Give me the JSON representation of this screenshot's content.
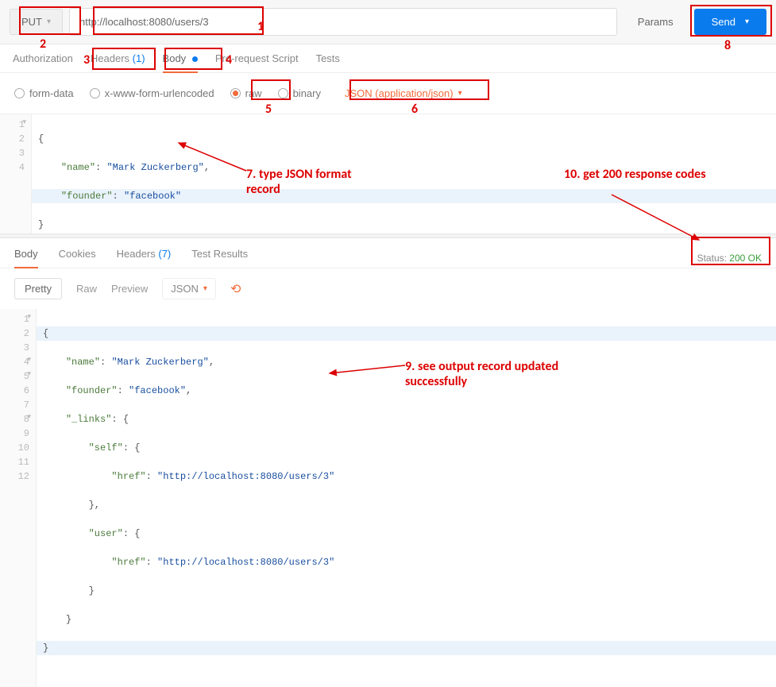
{
  "request": {
    "method": "PUT",
    "url": "http://localhost:8080/users/3",
    "params_btn": "Params",
    "send_btn": "Send"
  },
  "reqTabs": {
    "authorization": "Authorization",
    "headers": "Headers",
    "headers_count": "(1)",
    "body": "Body",
    "prerequest": "Pre-request Script",
    "tests": "Tests"
  },
  "bodyOpts": {
    "formdata": "form-data",
    "urlencoded": "x-www-form-urlencoded",
    "raw": "raw",
    "binary": "binary",
    "contentType": "JSON (application/json)"
  },
  "reqBody": {
    "l1": "{",
    "l2_k": "\"name\"",
    "l2_s": "\"Mark Zuckerberg\"",
    "l3_k": "\"founder\"",
    "l3_s": "\"facebook\"",
    "l4": "}"
  },
  "respTabs": {
    "body": "Body",
    "cookies": "Cookies",
    "headers": "Headers",
    "headers_count": "(7)",
    "testresults": "Test Results"
  },
  "status": {
    "label": "Status:",
    "value": "200 OK"
  },
  "respToolbar": {
    "pretty": "Pretty",
    "raw": "Raw",
    "preview": "Preview",
    "format": "JSON"
  },
  "respBody": {
    "l1": "{",
    "l2_k": "\"name\"",
    "l2_s": "\"Mark Zuckerberg\"",
    "l3_k": "\"founder\"",
    "l3_s": "\"facebook\"",
    "l4_k": "\"_links\"",
    "l5_k": "\"self\"",
    "l6_k": "\"href\"",
    "l6_s": "\"http://localhost:8080/users/3\"",
    "l7": "},",
    "l8_k": "\"user\"",
    "l9_k": "\"href\"",
    "l9_s": "\"http://localhost:8080/users/3\"",
    "l10": "}",
    "l11": "}",
    "l12": "}"
  },
  "annotations": {
    "a1": "1",
    "a2": "2",
    "a3": "3",
    "a4": "4",
    "a5": "5",
    "a6": "6",
    "a7": "7. type JSON format record",
    "a8": "8",
    "a9": "9. see output record updated successfully",
    "a10": "10. get 200 response codes"
  }
}
